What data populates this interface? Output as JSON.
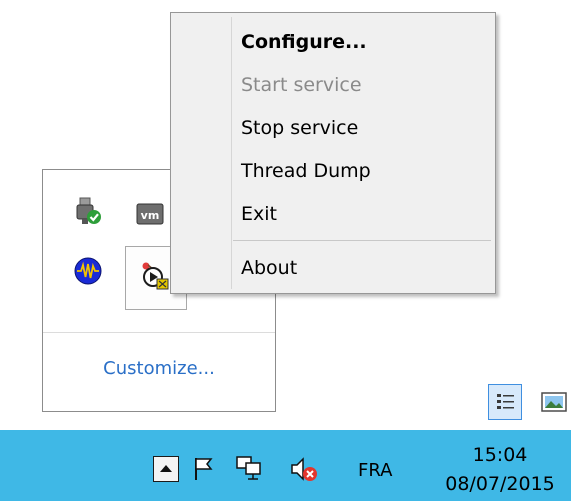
{
  "context_menu": {
    "items": [
      {
        "label": "Configure...",
        "state": "default"
      },
      {
        "label": "Start service",
        "state": "disabled"
      },
      {
        "label": "Stop service",
        "state": "normal"
      },
      {
        "label": "Thread Dump",
        "state": "normal"
      },
      {
        "label": "Exit",
        "state": "normal"
      },
      {
        "label": "About",
        "state": "normal"
      }
    ]
  },
  "tray_flyout": {
    "customize_label": "Customize...",
    "icons": [
      "usb-device-icon",
      "vmware-icon",
      "waveform-icon",
      "service-app-icon"
    ]
  },
  "taskbar": {
    "language": "FRA",
    "time": "15:04",
    "date": "08/07/2015",
    "icons": [
      "show-hidden-icons",
      "action-center-flag-icon",
      "network-icon",
      "volume-muted-icon"
    ]
  },
  "colors": {
    "taskbar": "#3fb8e6",
    "link": "#2a6fc7",
    "menu_background": "#f0f0f0",
    "disabled_text": "#8a8a8a"
  }
}
